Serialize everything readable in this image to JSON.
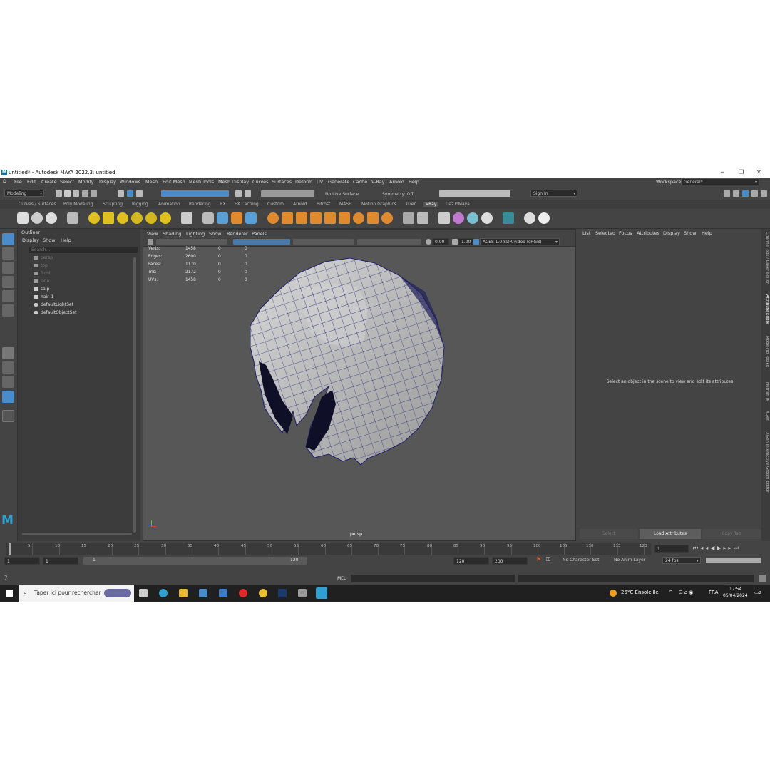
{
  "window": {
    "title": "untitled* - Autodesk MAYA 2022.3: untitled",
    "logo": "M"
  },
  "menubar": {
    "items": [
      "File",
      "Edit",
      "Create",
      "Select",
      "Modify",
      "Display",
      "Windows",
      "Mesh",
      "Edit Mesh",
      "Mesh Tools",
      "Mesh Display",
      "Curves",
      "Surfaces",
      "Deform",
      "UV",
      "Generate",
      "Cache",
      "V-Ray",
      "Arnold",
      "Help"
    ],
    "workspace_label": "Workspace:",
    "workspace_value": "General*"
  },
  "statusline": {
    "mode": "Modeling",
    "live_surface": "No Live Surface",
    "symmetry": "Symmetry: Off",
    "sign_in": "Sign In"
  },
  "shelf": {
    "tabs": [
      "Curves / Surfaces",
      "Poly Modeling",
      "Sculpting",
      "Rigging",
      "Animation",
      "Rendering",
      "FX",
      "FX Caching",
      "Custom",
      "Arnold",
      "Bifrost",
      "MASH",
      "Motion Graphics",
      "XGen",
      "VRay",
      "DazToMaya"
    ],
    "active_tab": "VRay"
  },
  "outliner": {
    "title": "Outliner",
    "menu": [
      "Display",
      "Show",
      "Help"
    ],
    "search_placeholder": "Search...",
    "items": [
      {
        "label": "persp",
        "dim": true
      },
      {
        "label": "top",
        "dim": true
      },
      {
        "label": "front",
        "dim": true
      },
      {
        "label": "side",
        "dim": true
      },
      {
        "label": "salp",
        "dim": false
      },
      {
        "label": "hair_1",
        "dim": false
      },
      {
        "label": "defaultLightSet",
        "dim": false
      },
      {
        "label": "defaultObjectSet",
        "dim": false
      }
    ]
  },
  "viewport": {
    "menu": [
      "View",
      "Shading",
      "Lighting",
      "Show",
      "Renderer",
      "Panels"
    ],
    "exposure": "0.00",
    "gamma": "1.00",
    "colorspace": "ACES 1.0 SDR-video (sRGB)",
    "hud": [
      {
        "label": "Verts:",
        "v1": "1458",
        "v2": "0",
        "v3": "0"
      },
      {
        "label": "Edges:",
        "v1": "2600",
        "v2": "0",
        "v3": "0"
      },
      {
        "label": "Faces:",
        "v1": "1170",
        "v2": "0",
        "v3": "0"
      },
      {
        "label": "Tris:",
        "v1": "2172",
        "v2": "0",
        "v3": "0"
      },
      {
        "label": "UVs:",
        "v1": "1458",
        "v2": "0",
        "v3": "0"
      }
    ],
    "camera": "persp"
  },
  "attribute_editor": {
    "menu": [
      "List",
      "Selected",
      "Focus",
      "Attributes",
      "Display",
      "Show",
      "Help"
    ],
    "message": "Select an object in the scene to view and edit its attributes",
    "buttons": {
      "select": "Select",
      "load": "Load Attributes",
      "copy": "Copy Tab"
    }
  },
  "side_tabs": [
    "Channel Box / Layer Editor",
    "Attribute Editor",
    "Modeling Toolkit",
    "Human IK",
    "XGen",
    "XGen Interactive Groom Editor"
  ],
  "timeline": {
    "ticks": [
      "5",
      "10",
      "15",
      "20",
      "25",
      "30",
      "35",
      "40",
      "45",
      "50",
      "55",
      "60",
      "65",
      "70",
      "75",
      "80",
      "85",
      "90",
      "95",
      "100",
      "105",
      "110",
      "115",
      "120"
    ],
    "current_frame": "1"
  },
  "range": {
    "start": "1",
    "start2": "1",
    "slider_start": "1",
    "slider_end": "120",
    "end": "120",
    "end2": "200",
    "character_set": "No Character Set",
    "anim_layer": "No Anim Layer",
    "fps": "24 fps"
  },
  "cmd": {
    "label": "MEL"
  },
  "taskbar": {
    "search": "Taper ici pour rechercher",
    "weather": "25°C  Ensoleillé",
    "lang": "FRA",
    "time": "17:54",
    "date": "05/04/2024",
    "notif": "2"
  }
}
